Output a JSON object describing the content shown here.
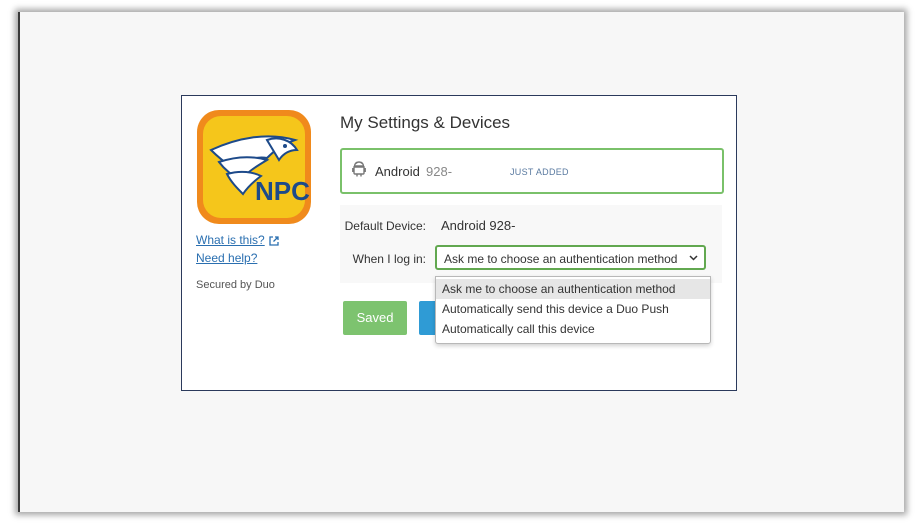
{
  "title": "My Settings & Devices",
  "sidebar": {
    "logo_text": "NPC",
    "what_link": "What is this?",
    "help_link": "Need help?",
    "secured": "Secured by Duo"
  },
  "device": {
    "icon": "android-icon",
    "name": "Android",
    "number": "928-",
    "tag": "JUST ADDED"
  },
  "settings": {
    "default_label": "Default Device:",
    "default_value": "Android 928-",
    "login_label": "When I log in:",
    "selected": "Ask me to choose an authentication method",
    "options": [
      "Ask me to choose an authentication method",
      "Automatically send this device a Duo Push",
      "Automatically call this device"
    ]
  },
  "buttons": {
    "saved": "Saved"
  },
  "colors": {
    "accent_green": "#7dc36f",
    "link_blue": "#2a6fb0",
    "button_blue": "#2f9bd5",
    "frame_border": "#2b3a5c"
  }
}
